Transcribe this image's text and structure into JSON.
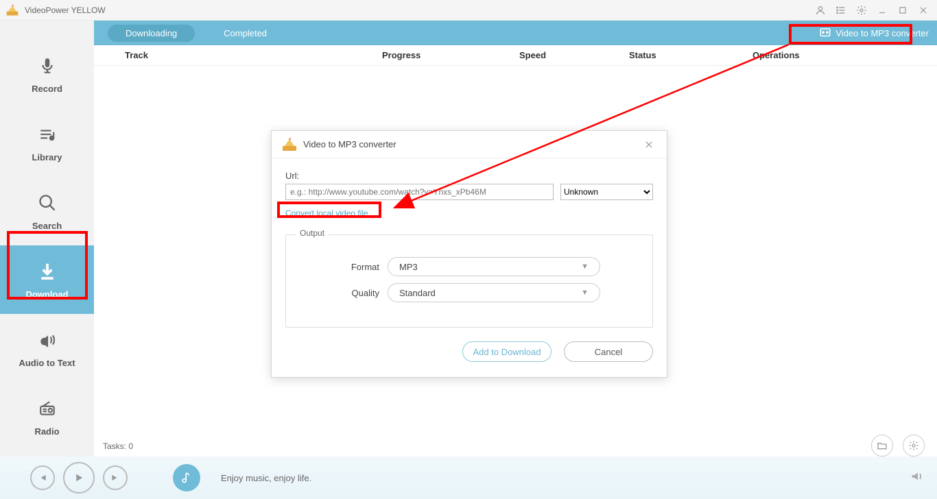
{
  "app": {
    "title": "VideoPower YELLOW"
  },
  "sidebar": {
    "items": [
      {
        "label": "Record"
      },
      {
        "label": "Library"
      },
      {
        "label": "Search"
      },
      {
        "label": "Download"
      },
      {
        "label": "Audio to Text"
      },
      {
        "label": "Radio"
      }
    ]
  },
  "tabs": {
    "downloading": "Downloading",
    "completed": "Completed",
    "converter": "Video to MP3 converter"
  },
  "columns": {
    "track": "Track",
    "progress": "Progress",
    "speed": "Speed",
    "status": "Status",
    "operations": "Operations"
  },
  "tasks_label": "Tasks: 0",
  "player": {
    "tagline": "Enjoy music, enjoy life."
  },
  "dialog": {
    "title": "Video to MP3 converter",
    "url_label": "Url:",
    "url_placeholder": "e.g.: http://www.youtube.com/watch?v=Ynxs_xPb46M",
    "source_select": "Unknown",
    "convert_local": "Convert local video file",
    "output_legend": "Output",
    "format_label": "Format",
    "format_value": "MP3",
    "quality_label": "Quality",
    "quality_value": "Standard",
    "add_btn": "Add to Download",
    "cancel_btn": "Cancel"
  }
}
